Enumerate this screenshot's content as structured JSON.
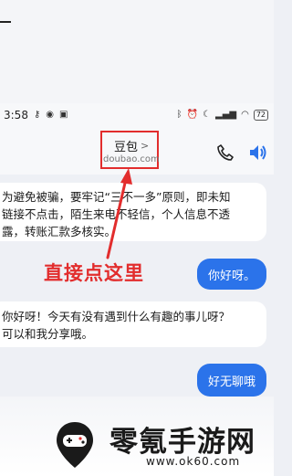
{
  "status_bar": {
    "time": "3:58",
    "icons_left": [
      "key-icon",
      "eye-icon",
      "nfc-icon"
    ],
    "icons_right": [
      "bluetooth-icon",
      "alarm-icon",
      "moon-icon",
      "signal-icon",
      "wifi-icon"
    ],
    "battery": "72"
  },
  "nav": {
    "title": "豆包",
    "chevron": ">",
    "subtitle": "doubao.com"
  },
  "messages": [
    {
      "role": "bot",
      "text_line1": "为避免被骗，要牢记“三不一多”原则，即未知",
      "text_line2": "链接不点击，陌生来电不轻信，个人信息不透",
      "text_line3": "露，转账汇款多核实。"
    },
    {
      "role": "user",
      "text": "你好呀。"
    },
    {
      "role": "bot",
      "text_line1": "你好呀！今天有没有遇到什么有趣的事儿呀？",
      "text_line2": "可以和我分享哦。"
    },
    {
      "role": "user",
      "text": "好无聊哦"
    }
  ],
  "annotation": {
    "text": "直接点这里",
    "color": "#e22d2d"
  },
  "footer": {
    "brand": "零氪手游网",
    "url": "www.ok60.com"
  },
  "colors": {
    "accent": "#2b73ea",
    "highlight": "#e22d2d"
  }
}
